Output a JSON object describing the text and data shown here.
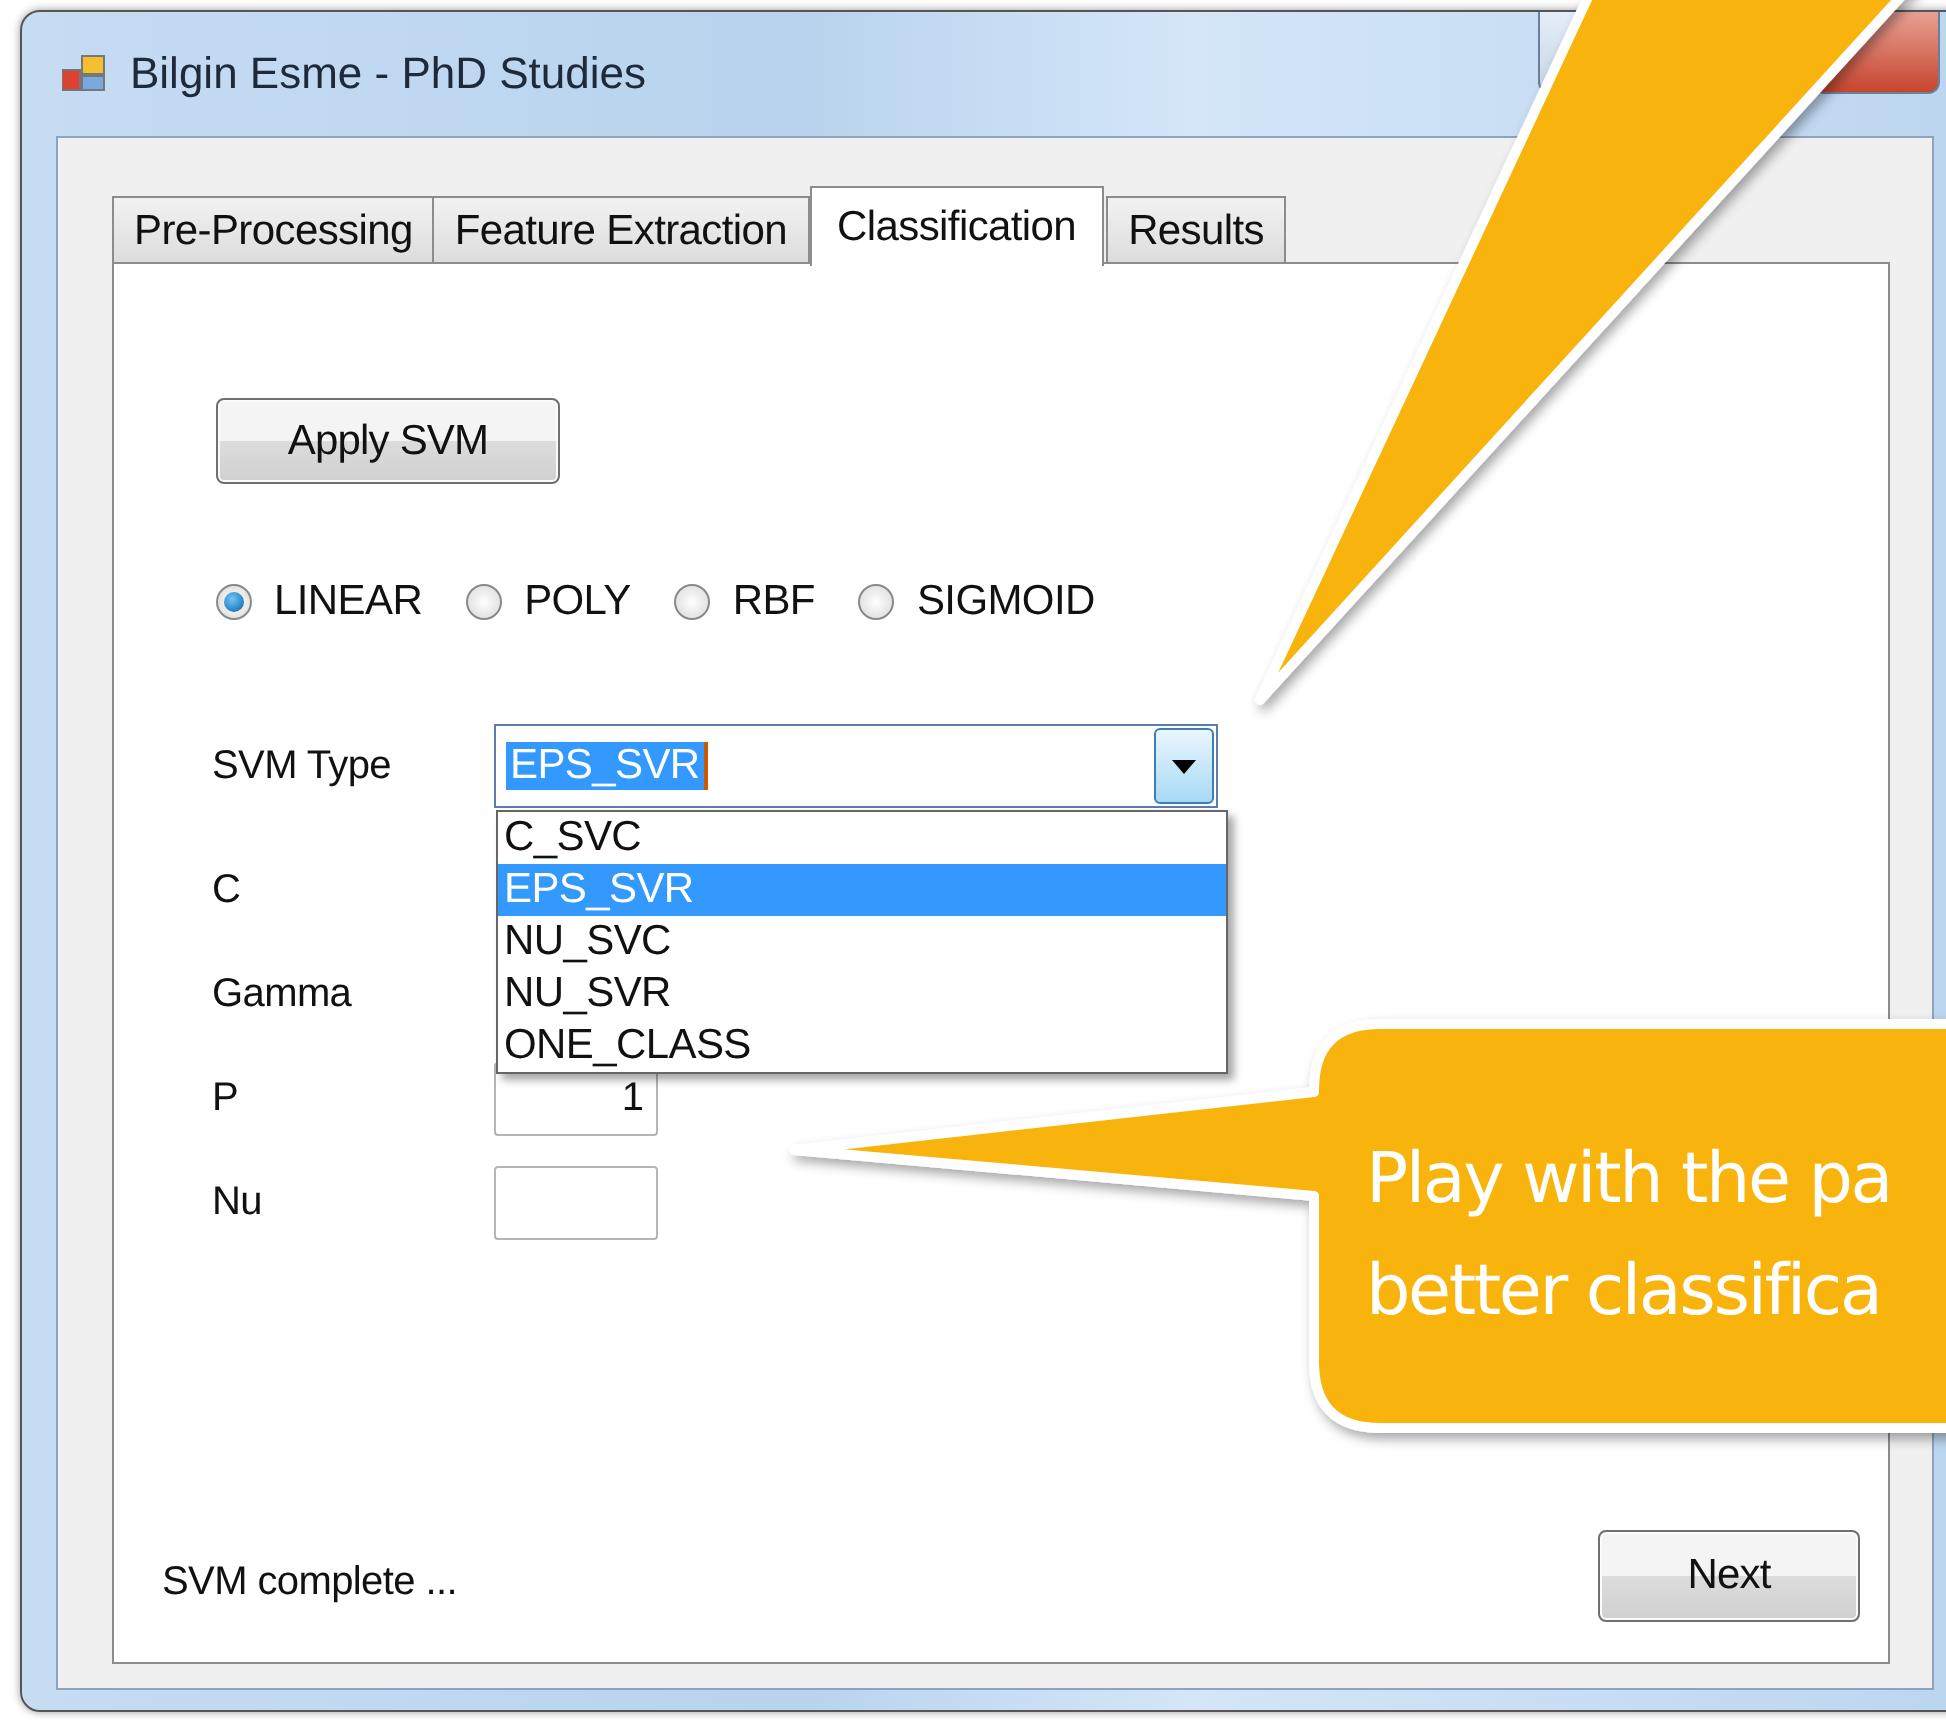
{
  "window": {
    "title": "Bilgin Esme - PhD Studies"
  },
  "tabs": [
    {
      "label": "Pre-Processing",
      "selected": false
    },
    {
      "label": "Feature Extraction",
      "selected": false
    },
    {
      "label": "Classification",
      "selected": true
    },
    {
      "label": "Results",
      "selected": false
    }
  ],
  "apply_button": "Apply SVM",
  "kernels": [
    {
      "label": "LINEAR",
      "selected": true
    },
    {
      "label": "POLY",
      "selected": false
    },
    {
      "label": "RBF",
      "selected": false
    },
    {
      "label": "SIGMOID",
      "selected": false
    }
  ],
  "svm_type": {
    "label": "SVM Type",
    "value": "EPS_SVR",
    "expanded": true,
    "options": [
      {
        "label": "C_SVC",
        "selected": false
      },
      {
        "label": "EPS_SVR",
        "selected": true
      },
      {
        "label": "NU_SVC",
        "selected": false
      },
      {
        "label": "NU_SVR",
        "selected": false
      },
      {
        "label": "ONE_CLASS",
        "selected": false
      }
    ]
  },
  "parameters": [
    {
      "label": "C",
      "kind": "covered"
    },
    {
      "label": "Gamma",
      "kind": "covered"
    },
    {
      "label": "P",
      "kind": "field",
      "value": "1"
    },
    {
      "label": "Nu",
      "kind": "field"
    }
  ],
  "status": "SVM complete ...",
  "next_button": "Next",
  "callouts": [
    {
      "kind": "pointer"
    },
    {
      "kind": "bubble",
      "lines": [
        "Play with the pa",
        "better classifica"
      ]
    }
  ]
}
